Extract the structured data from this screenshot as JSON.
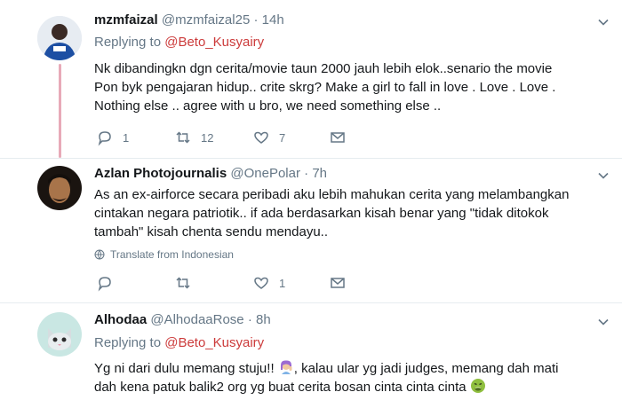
{
  "tweets": [
    {
      "name": "mzmfaizal",
      "handle": "@mzmfaizal25",
      "dot": "·",
      "time": "14h",
      "replying_prefix": "Replying to",
      "replying_to": "@Beto_Kusyairy",
      "lines": [
        "Nk dibandingkn dgn cerita/movie taun 2000 jauh lebih elok..senario the movie",
        "Pon byk pengajaran hidup.. crite skrg? Make a girl to fall in love . Love . Love .",
        "Nothing else .. agree with u bro, we need something else .."
      ],
      "reply_count": "1",
      "retweet_count": "12",
      "like_count": "7"
    },
    {
      "name": "Azlan Photojournalis",
      "handle": "@OnePolar",
      "dot": "·",
      "time": "7h",
      "lines": [
        "As an ex-airforce secara peribadi aku lebih mahukan cerita yang melambangkan",
        "cintakan negara patriotik.. if ada berdasarkan kisah benar yang \"tidak ditokok",
        "tambah\" kisah chenta sendu mendayu.."
      ],
      "translate": "Translate from Indonesian",
      "reply_count": "",
      "retweet_count": "",
      "like_count": "1"
    },
    {
      "name": "Alhodaa",
      "handle": "@AlhodaaRose",
      "dot": "·",
      "time": "8h",
      "replying_prefix": "Replying to",
      "replying_to": "@Beto_Kusyairy",
      "line1_a": "Yg ni dari dulu memang stuju!! ",
      "line1_b": ", kalau ular yg jadi judges, memang dah mati",
      "line2": "dah kena patuk balik2 org yg buat cerita bosan cinta cinta cinta "
    }
  ],
  "colors": {
    "mention": "#cc3b3b",
    "thread_line": "#e8aab8",
    "muted": "#657786"
  },
  "icons": [
    "reply-icon",
    "retweet-icon",
    "like-icon",
    "dm-icon",
    "chevron-down-icon",
    "globe-icon",
    "woman-gesturing-emoji",
    "nauseated-face-emoji"
  ]
}
